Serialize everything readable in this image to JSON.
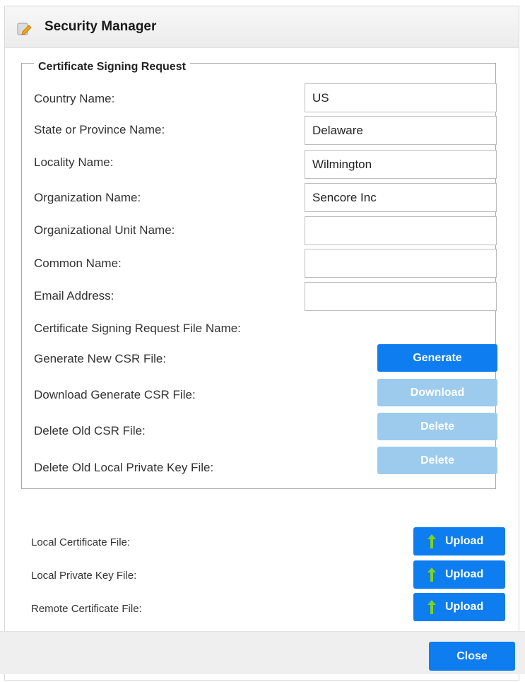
{
  "window": {
    "title": "Security Manager",
    "icon": "pencil-note-icon"
  },
  "csr": {
    "legend": "Certificate Signing Request",
    "fields": {
      "country": {
        "label": "Country Name:",
        "value": "US"
      },
      "state": {
        "label": "State or Province Name:",
        "value": "Delaware"
      },
      "locality": {
        "label": "Locality Name:",
        "value": "Wilmington"
      },
      "organization": {
        "label": "Organization Name:",
        "value": "Sencore Inc"
      },
      "org_unit": {
        "label": "Organizational Unit Name:",
        "value": ""
      },
      "common_name": {
        "label": "Common Name:",
        "value": ""
      },
      "email": {
        "label": "Email Address:",
        "value": ""
      }
    },
    "file_name_label": "Certificate Signing Request File Name:",
    "actions": {
      "generate": {
        "label": "Generate New CSR File:",
        "button": "Generate"
      },
      "download": {
        "label": "Download Generate CSR File:",
        "button": "Download"
      },
      "delete_csr": {
        "label": "Delete Old CSR File:",
        "button": "Delete"
      },
      "delete_key": {
        "label": "Delete Old Local Private Key File:",
        "button": "Delete"
      }
    }
  },
  "uploads": {
    "local_cert": {
      "label": "Local Certificate File:",
      "button": "Upload"
    },
    "local_key": {
      "label": "Local Private Key File:",
      "button": "Upload"
    },
    "remote_cert": {
      "label": "Remote Certificate File:",
      "button": "Upload"
    }
  },
  "footer": {
    "close": "Close"
  },
  "colors": {
    "primary": "#0d7df0",
    "disabled": "#9ccbee",
    "upload_arrow": "#7ed321"
  }
}
